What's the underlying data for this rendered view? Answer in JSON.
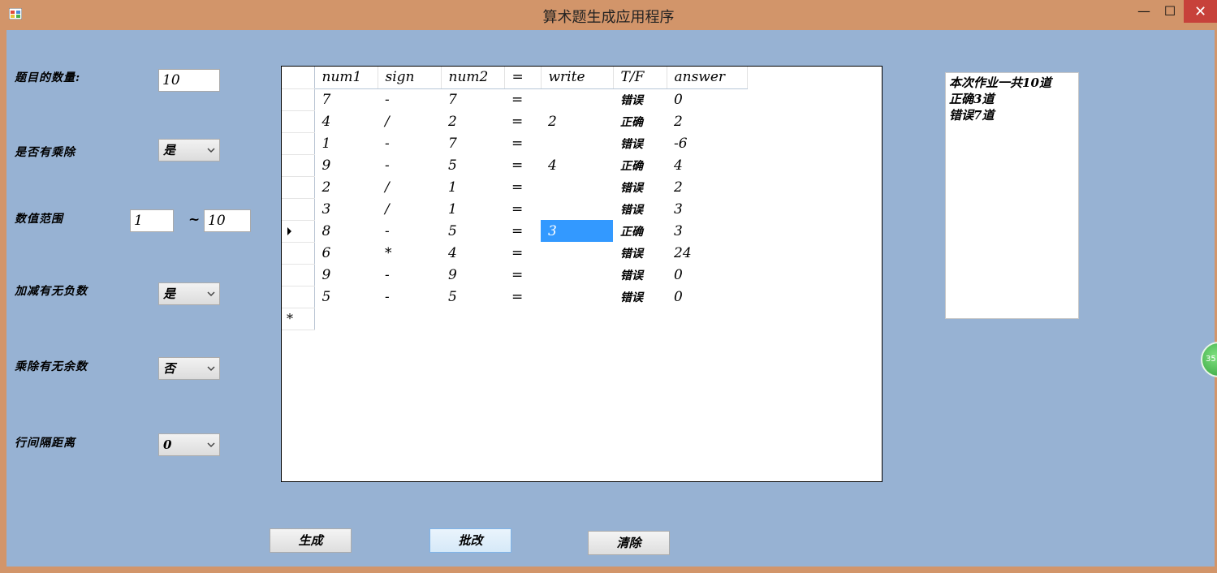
{
  "window": {
    "title": "算术题生成应用程序",
    "minimize_glyph": "—",
    "maximize_glyph": "☐",
    "close_glyph": "✕"
  },
  "settings": {
    "count_label": "题目的数量:",
    "count_value": "10",
    "muldiv_label": "是否有乘除",
    "muldiv_value": "是",
    "range_label": "数值范围",
    "range_min": "1",
    "range_sep": "~",
    "range_max": "10",
    "negative_label": "加减有无负数",
    "negative_value": "是",
    "remainder_label": "乘除有无余数",
    "remainder_value": "否",
    "spacing_label": "行间隔距离",
    "spacing_value": "0"
  },
  "grid": {
    "columns": [
      "num1",
      "sign",
      "num2",
      "=",
      "write",
      "T/F",
      "answer"
    ],
    "rows": [
      {
        "num1": "7",
        "sign": "-",
        "num2": "7",
        "eq": "=",
        "write": "",
        "tf": "错误",
        "answer": "0"
      },
      {
        "num1": "4",
        "sign": "/",
        "num2": "2",
        "eq": "=",
        "write": "2",
        "tf": "正确",
        "answer": "2"
      },
      {
        "num1": "1",
        "sign": "-",
        "num2": "7",
        "eq": "=",
        "write": "",
        "tf": "错误",
        "answer": "-6"
      },
      {
        "num1": "9",
        "sign": "-",
        "num2": "5",
        "eq": "=",
        "write": "4",
        "tf": "正确",
        "answer": "4"
      },
      {
        "num1": "2",
        "sign": "/",
        "num2": "1",
        "eq": "=",
        "write": "",
        "tf": "错误",
        "answer": "2"
      },
      {
        "num1": "3",
        "sign": "/",
        "num2": "1",
        "eq": "=",
        "write": "",
        "tf": "错误",
        "answer": "3"
      },
      {
        "num1": "8",
        "sign": "-",
        "num2": "5",
        "eq": "=",
        "write": "3",
        "tf": "正确",
        "answer": "3"
      },
      {
        "num1": "6",
        "sign": "*",
        "num2": "4",
        "eq": "=",
        "write": "",
        "tf": "错误",
        "answer": "24"
      },
      {
        "num1": "9",
        "sign": "-",
        "num2": "9",
        "eq": "=",
        "write": "",
        "tf": "错误",
        "answer": "0"
      },
      {
        "num1": "5",
        "sign": "-",
        "num2": "5",
        "eq": "=",
        "write": "",
        "tf": "错误",
        "answer": "0"
      }
    ],
    "new_row_marker": "*"
  },
  "result": {
    "text": "本次作业一共10道\n正确3道\n错误7道"
  },
  "buttons": {
    "generate": "生成",
    "grade": "批改",
    "clear": "清除"
  },
  "floater": {
    "text": "35"
  },
  "colors": {
    "titlebar": "#d2956a",
    "client": "#97b2d3",
    "selection": "#3399ff",
    "close": "#c7413a"
  }
}
